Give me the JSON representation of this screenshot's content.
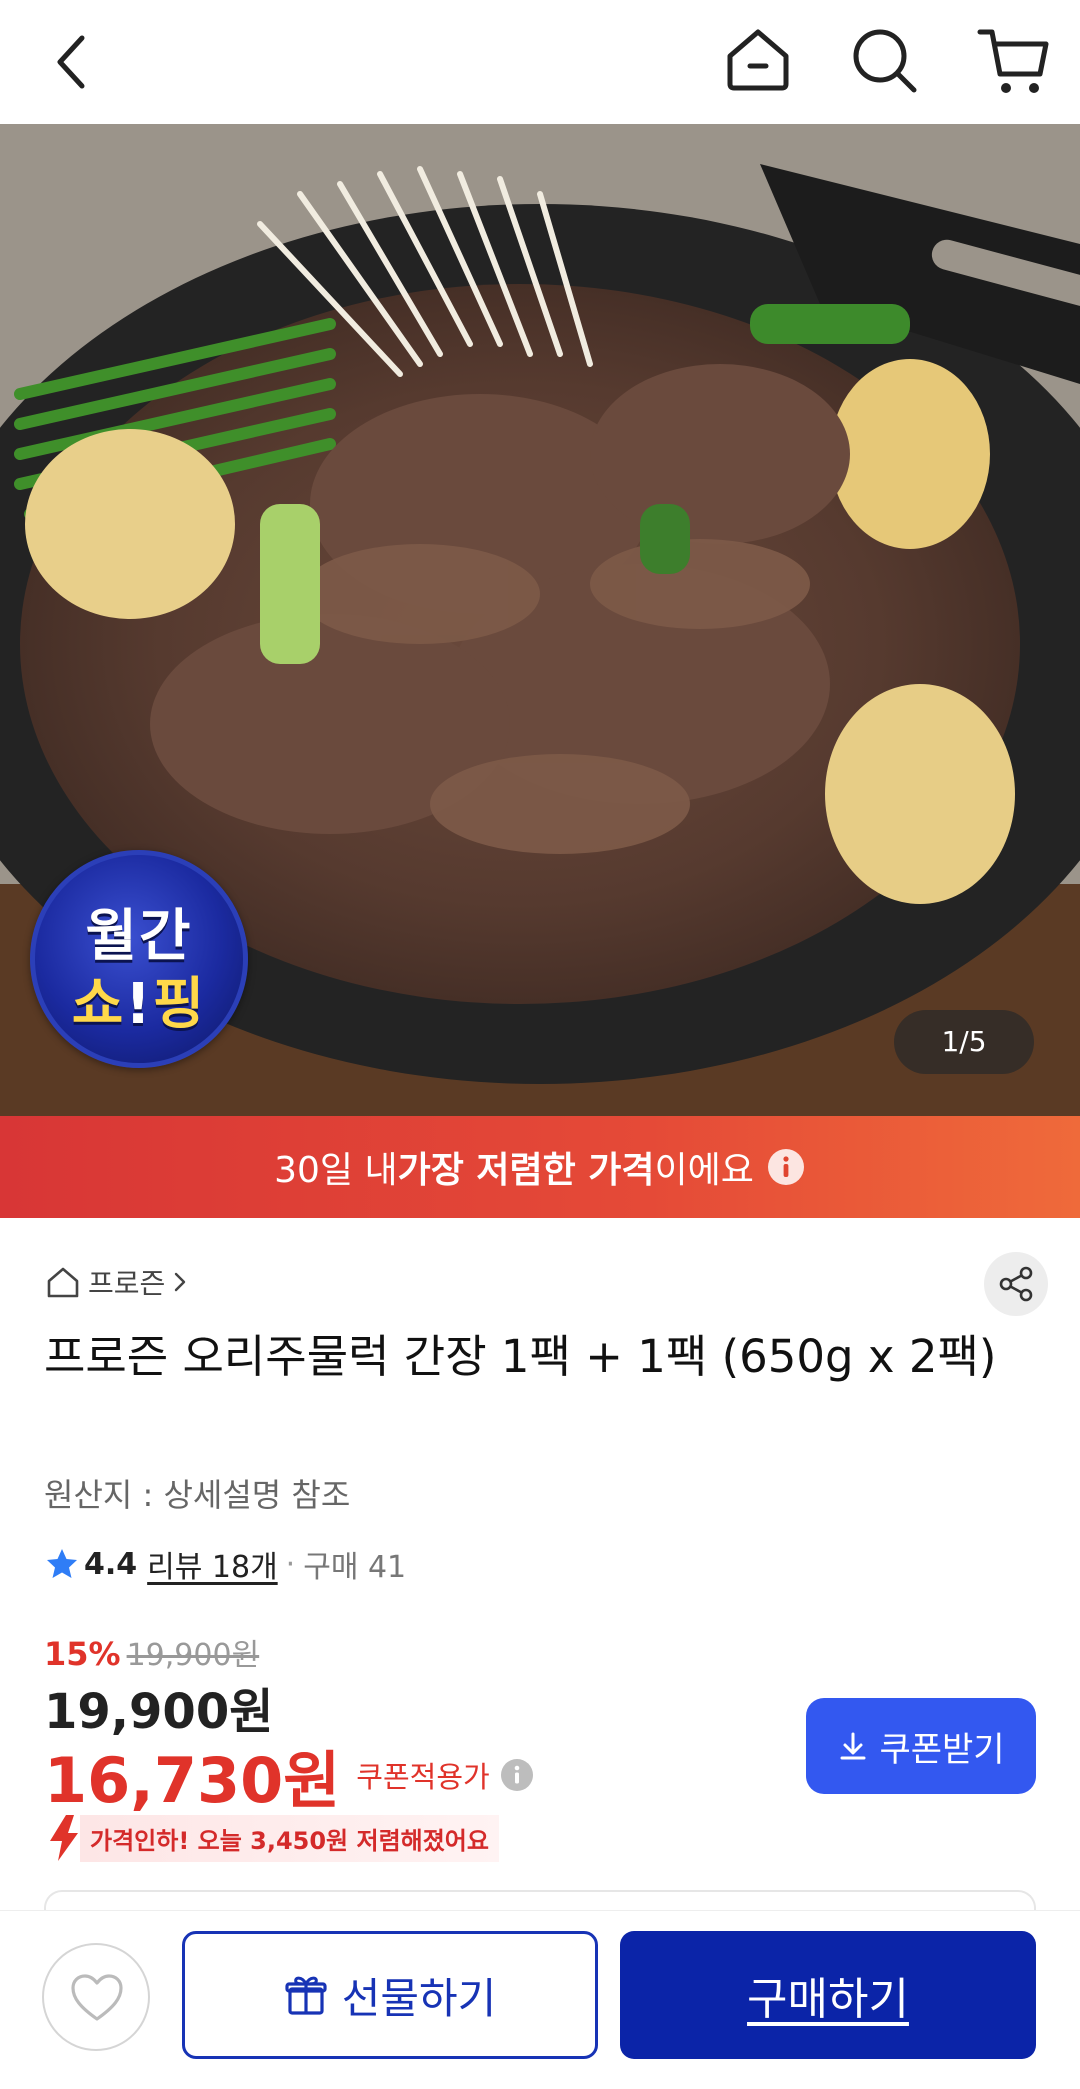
{
  "header": {
    "back_icon": "chevron-left-icon",
    "home_icon": "home-icon",
    "search_icon": "search-icon",
    "cart_icon": "cart-icon"
  },
  "hero": {
    "badge_line1": "월간",
    "badge_line2_a": "쇼",
    "badge_line2_b": "!",
    "badge_line2_c": "핑",
    "counter": "1/5"
  },
  "banner": {
    "prefix": "30일 내 ",
    "highlight": "가장 저렴한 가격",
    "suffix": "이에요",
    "icon": "info-icon"
  },
  "product": {
    "category": "프로즌",
    "title": "프로즌 오리주물럭 간장 1팩 + 1팩 (650g x 2팩)",
    "origin": "원산지 : 상세설명 참조",
    "rating": "4.4",
    "reviews": "리뷰 18개",
    "separator": "·",
    "purchases": "구매 41"
  },
  "pricing": {
    "discount_pct": "15%",
    "original_price": "19,900원",
    "price": "19,900원",
    "coupon_price": "16,730원",
    "coupon_label": "쿠폰적용가",
    "coupon_button": "쿠폰받기",
    "price_drop_note": "가격인하! 오늘 3,450원 저렴해졌어요"
  },
  "bottom": {
    "wish_icon": "heart-icon",
    "gift_label": "선물하기",
    "buy_label": "구매하기"
  },
  "colors": {
    "accent_red": "#e0332a",
    "banner_red": "#d83636",
    "coupon_blue": "#3358f0",
    "buy_navy": "#0b24a8"
  }
}
